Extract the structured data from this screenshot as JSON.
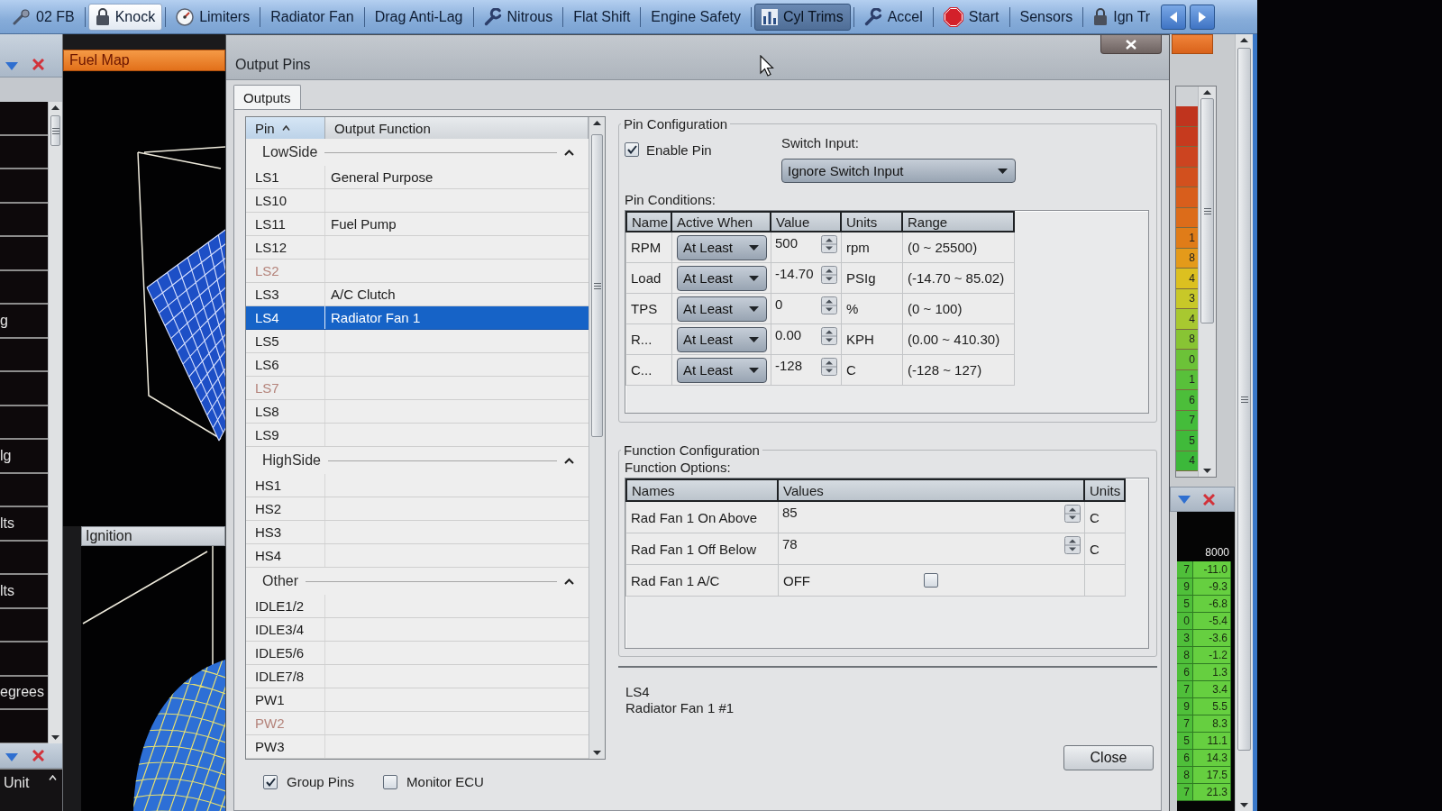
{
  "toolbar": {
    "items": [
      {
        "label": "02 FB",
        "kind": "sensor",
        "selected": false,
        "highlighted": false
      },
      {
        "label": "Knock",
        "kind": "lock",
        "selected": true,
        "highlighted": false
      },
      {
        "label": "Limiters",
        "kind": "gauge",
        "selected": false,
        "highlighted": false
      },
      {
        "label": "Radiator Fan",
        "kind": "plain",
        "selected": false,
        "highlighted": false
      },
      {
        "label": "Drag Anti-Lag",
        "kind": "plain",
        "selected": false,
        "highlighted": false
      },
      {
        "label": "Nitrous",
        "kind": "tool",
        "selected": false,
        "highlighted": false
      },
      {
        "label": "Flat Shift",
        "kind": "plain",
        "selected": false,
        "highlighted": false
      },
      {
        "label": "Engine Safety",
        "kind": "plain",
        "selected": false,
        "highlighted": false
      },
      {
        "label": "Cyl Trims",
        "kind": "chart",
        "selected": false,
        "highlighted": true
      },
      {
        "label": "Accel",
        "kind": "tool",
        "selected": false,
        "highlighted": false
      },
      {
        "label": "Start",
        "kind": "stop",
        "selected": false,
        "highlighted": false
      },
      {
        "label": "Sensors",
        "kind": "plain",
        "selected": false,
        "highlighted": false
      },
      {
        "label": "Ign Tr",
        "kind": "lock",
        "selected": false,
        "highlighted": false
      }
    ]
  },
  "left_panel": {
    "rows": [
      {
        "kind": "empty"
      },
      {
        "kind": "empty"
      },
      {
        "kind": "empty"
      },
      {
        "kind": "empty"
      },
      {
        "kind": "empty"
      },
      {
        "kind": "empty"
      },
      {
        "kind": "text",
        "label": "g"
      },
      {
        "kind": "empty"
      },
      {
        "kind": "empty"
      },
      {
        "kind": "empty"
      },
      {
        "kind": "text",
        "label": "lg"
      },
      {
        "kind": "empty"
      },
      {
        "kind": "text",
        "label": "lts"
      },
      {
        "kind": "empty"
      },
      {
        "kind": "text",
        "label": "lts"
      },
      {
        "kind": "empty"
      },
      {
        "kind": "empty"
      },
      {
        "kind": "text",
        "label": "egrees"
      },
      {
        "kind": "empty"
      }
    ],
    "footer": {
      "label": "Unit"
    }
  },
  "fuel_map": {
    "title": "Fuel Map"
  },
  "ignition": {
    "title": "Ignition"
  },
  "dialog": {
    "title": "Output Pins",
    "tabs": [
      {
        "label": "Outputs",
        "selected": true
      }
    ],
    "pin_list": {
      "columns": [
        {
          "label": "Pin",
          "sorted": true
        },
        {
          "label": "Output Function",
          "sorted": false
        }
      ],
      "groups": [
        {
          "label": "LowSide",
          "expanded": true,
          "rows": [
            {
              "pin": "LS1",
              "function": "General Purpose",
              "selected": false,
              "disabled": false
            },
            {
              "pin": "LS10",
              "selected": false,
              "disabled": false
            },
            {
              "pin": "LS11",
              "function": "Fuel Pump",
              "selected": false,
              "disabled": false
            },
            {
              "pin": "LS12",
              "selected": false,
              "disabled": false
            },
            {
              "pin": "LS2",
              "selected": false,
              "disabled": true
            },
            {
              "pin": "LS3",
              "function": "A/C Clutch",
              "selected": false,
              "disabled": false
            },
            {
              "pin": "LS4",
              "function": "Radiator Fan 1",
              "selected": true,
              "disabled": false
            },
            {
              "pin": "LS5",
              "selected": false,
              "disabled": false
            },
            {
              "pin": "LS6",
              "selected": false,
              "disabled": false
            },
            {
              "pin": "LS7",
              "selected": false,
              "disabled": true
            },
            {
              "pin": "LS8",
              "selected": false,
              "disabled": false
            },
            {
              "pin": "LS9",
              "selected": false,
              "disabled": false
            }
          ]
        },
        {
          "label": "HighSide",
          "expanded": true,
          "rows": [
            {
              "pin": "HS1",
              "selected": false,
              "disabled": false
            },
            {
              "pin": "HS2",
              "selected": false,
              "disabled": false
            },
            {
              "pin": "HS3",
              "selected": false,
              "disabled": false
            },
            {
              "pin": "HS4",
              "selected": false,
              "disabled": false
            }
          ]
        },
        {
          "label": "Other",
          "expanded": true,
          "rows": [
            {
              "pin": "IDLE1/2",
              "selected": false,
              "disabled": false
            },
            {
              "pin": "IDLE3/4",
              "selected": false,
              "disabled": false
            },
            {
              "pin": "IDLE5/6",
              "selected": false,
              "disabled": false
            },
            {
              "pin": "IDLE7/8",
              "selected": false,
              "disabled": false
            },
            {
              "pin": "PW1",
              "selected": false,
              "disabled": false
            },
            {
              "pin": "PW2",
              "selected": false,
              "disabled": true
            },
            {
              "pin": "PW3",
              "selected": false,
              "disabled": false
            }
          ]
        }
      ]
    },
    "options": [
      {
        "label": "Group Pins",
        "checked": true
      },
      {
        "label": "Monitor ECU",
        "checked": false
      }
    ],
    "pin_configuration": {
      "title": "Pin Configuration",
      "enable_pin": {
        "label": "Enable Pin",
        "checked": true
      },
      "switch_input": {
        "label": "Switch Input:",
        "value": "Ignore Switch Input"
      },
      "conditions": {
        "label": "Pin Conditions:",
        "columns": [
          "Name",
          "Active When",
          "Value",
          "Units",
          "Range"
        ],
        "rows": [
          {
            "name": "RPM",
            "active_when": "At Least",
            "value": "500",
            "units": "rpm",
            "range": "(0 ~ 25500)"
          },
          {
            "name": "Load",
            "active_when": "At Least",
            "value": "-14.70",
            "units": "PSIg",
            "range": "(-14.70 ~ 85.02)"
          },
          {
            "name": "TPS",
            "active_when": "At Least",
            "value": "0",
            "units": "%",
            "range": "(0 ~ 100)"
          },
          {
            "name": "R...",
            "active_when": "At Least",
            "value": "0.00",
            "units": "KPH",
            "range": "(0.00 ~ 410.30)"
          },
          {
            "name": "C...",
            "active_when": "At Least",
            "value": "-128",
            "units": "C",
            "range": "(-128 ~ 127)"
          }
        ]
      }
    },
    "function_configuration": {
      "title": "Function Configuration",
      "label": "Function Options:",
      "columns": [
        "Names",
        "Values",
        "Units"
      ],
      "rows": [
        {
          "kind": "number",
          "name": "Rad Fan 1 On Above",
          "value": "85",
          "units": "C"
        },
        {
          "kind": "number",
          "name": "Rad Fan 1 Off Below",
          "value": "78",
          "units": "C"
        },
        {
          "kind": "toggle",
          "name": "Rad Fan 1 A/C",
          "value": "OFF",
          "checked": false
        }
      ]
    },
    "status": [
      "LS4",
      "Radiator Fan 1 #1"
    ],
    "close_button": "Close"
  },
  "right_panel": {
    "heat_cells": [
      {
        "color": "#c0341e"
      },
      {
        "color": "#c63a1e"
      },
      {
        "color": "#cc4420"
      },
      {
        "color": "#d2501e"
      },
      {
        "color": "#d85e1c"
      },
      {
        "color": "#dc6c1a"
      },
      {
        "text": "1",
        "color": "#e07c18"
      },
      {
        "text": "8",
        "color": "#e49a1a"
      },
      {
        "text": "4",
        "color": "#dcc020"
      },
      {
        "text": "3",
        "color": "#c8c828"
      },
      {
        "text": "4",
        "color": "#a8c830"
      },
      {
        "text": "8",
        "color": "#88c434"
      },
      {
        "text": "0",
        "color": "#6cc238"
      },
      {
        "text": "1",
        "color": "#58c03a"
      },
      {
        "text": "6",
        "color": "#4cbe3a"
      },
      {
        "text": "7",
        "color": "#44bc3a"
      },
      {
        "text": "5",
        "color": "#40ba3a"
      },
      {
        "text": "4",
        "color": "#3cb83a"
      }
    ],
    "table": {
      "header": "8000",
      "rows": [
        {
          "column_1": "7",
          "value": "-11.0"
        },
        {
          "column_1": "9",
          "value": "-9.3"
        },
        {
          "column_1": "5",
          "value": "-6.8"
        },
        {
          "column_1": "0",
          "value": "-5.4"
        },
        {
          "column_1": "3",
          "value": "-3.6"
        },
        {
          "column_1": "8",
          "value": "-1.2"
        },
        {
          "column_1": "6",
          "value": "1.3"
        },
        {
          "column_1": "7",
          "value": "3.4"
        },
        {
          "column_1": "9",
          "value": "5.5"
        },
        {
          "column_1": "7",
          "value": "8.3"
        },
        {
          "column_1": "5",
          "value": "11.1"
        },
        {
          "column_1": "6",
          "value": "14.3"
        },
        {
          "column_1": "8",
          "value": "17.5"
        },
        {
          "column_1": "7",
          "value": "21.3"
        }
      ]
    }
  }
}
